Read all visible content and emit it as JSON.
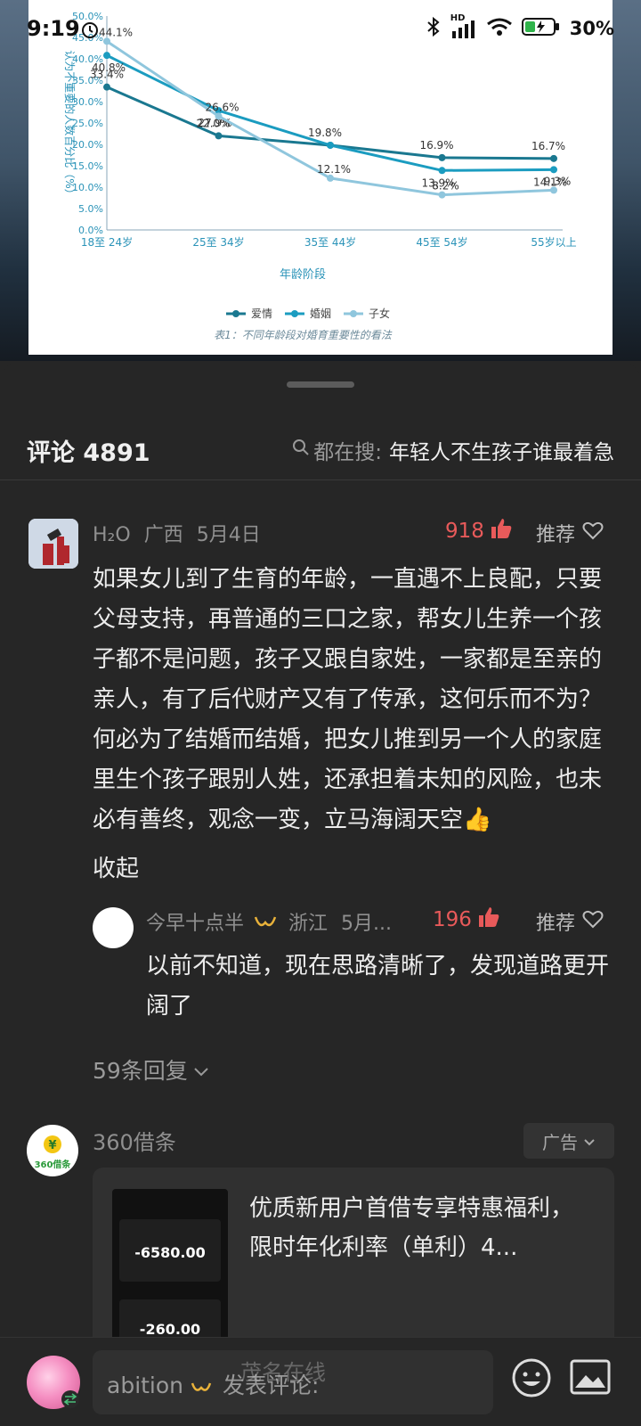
{
  "status_bar": {
    "time": "9:19",
    "network": "HD",
    "battery": "30%"
  },
  "chart_data": {
    "type": "line",
    "categories": [
      "18至 24岁",
      "25至 34岁",
      "35至 44岁",
      "45至 54岁",
      "55岁以上"
    ],
    "series": [
      {
        "name": "爱情",
        "values": [
          33.4,
          22.0,
          19.8,
          16.9,
          16.7
        ],
        "labels": [
          "33.4%",
          "22.0%",
          "19.8%",
          "16.9%",
          "16.7%"
        ],
        "color": "#1a7890"
      },
      {
        "name": "婚姻",
        "values": [
          40.8,
          27.9,
          19.8,
          13.9,
          14.1
        ],
        "labels": [
          "40.8%",
          "27.9%",
          "",
          "13.9%",
          "14.1%"
        ],
        "color": "#1b9cc0"
      },
      {
        "name": "子女",
        "values": [
          44.1,
          26.6,
          12.1,
          8.2,
          9.3
        ],
        "labels": [
          "44.1%",
          "26.6%",
          "12.1%",
          "8.2%",
          "9.3%"
        ],
        "color": "#8fc6dd"
      }
    ],
    "yticks": [
      "0.0%",
      "5.0%",
      "10.0%",
      "15.0%",
      "20.0%",
      "25.0%",
      "30.0%",
      "35.0%",
      "40.0%",
      "45.0%",
      "50.0%"
    ],
    "ylim": [
      0,
      50
    ],
    "xlabel": "年龄阶段",
    "ylabel": "认为不重要的人数百分比（%）",
    "caption": "表1：不同年龄段对婚育重要性的看法",
    "legend_position": "bottom"
  },
  "comments_header": {
    "title": "评论 4891",
    "search_prefix": "都在搜:",
    "search_term": "年轻人不生孩子谁最着急"
  },
  "comment": {
    "user": "H₂O",
    "region": "广西",
    "date": "5月4日",
    "likes": "918",
    "recommend": "推荐",
    "text": "如果女儿到了生育的年龄，一直遇不上良配，只要父母支持，再普通的三口之家，帮女儿生养一个孩子都不是问题，孩子又跟自家姓，一家都是至亲的亲人，有了后代财产又有了传承，这何乐而不为？何必为了结婚而结婚，把女儿推到另一个人的家庭里生个孩子跟别人姓，还承担着未知的风险，也未必有善终，观念一变，立马海阔天空👍",
    "collapse": "收起"
  },
  "reply": {
    "user": "今早十点半",
    "region": "浙江",
    "date": "5月...",
    "likes": "196",
    "recommend": "推荐",
    "text": "以前不知道，现在思路清晰了，发现道路更开阔了"
  },
  "more_replies": "59条回复",
  "ad": {
    "name": "360借条",
    "badge": "广告",
    "logo_text": "360借条",
    "title": "优质新用户首借专享特惠福利，限时年化利率（单利）4...",
    "thumb_amount_1": "-6580.00",
    "thumb_amount_2": "-260.00"
  },
  "bottom_bar": {
    "user": "abition",
    "placeholder": "发表评论:"
  },
  "watermark": "茂名在线"
}
